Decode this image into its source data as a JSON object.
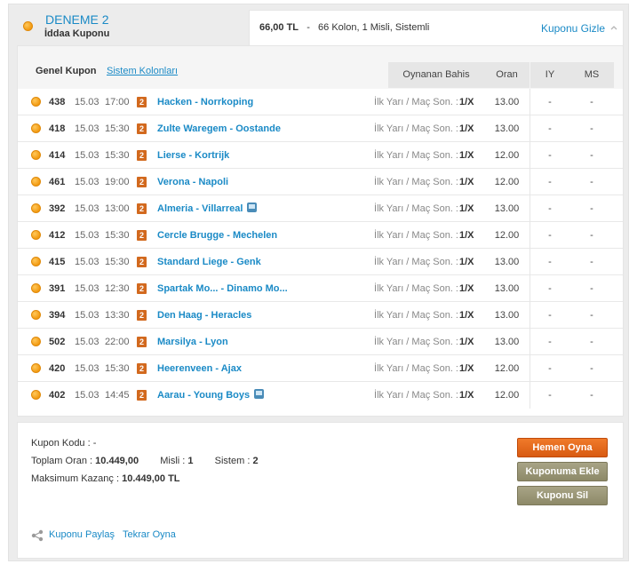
{
  "header": {
    "title": "DENEME 2",
    "subtitle": "İddaa Kuponu",
    "amount": "66,00 TL",
    "summary": "66 Kolon, 1 Misli, Sistemli",
    "hide_label": "Kuponu Gizle"
  },
  "tabs": {
    "general": "Genel Kupon",
    "system": "Sistem Kolonları"
  },
  "columns": {
    "bet": "Oynanan Bahis",
    "odds": "Oran",
    "iy": "IY",
    "ms": "MS"
  },
  "matches": [
    {
      "code": "438",
      "date": "15.03",
      "time": "17:00",
      "badge": "2",
      "teams": "Hacken - Norrkoping",
      "tv": false,
      "bet": "İlk Yarı / Maç Son. :",
      "sel": "1/X",
      "odds": "13.00",
      "iy": "-",
      "ms": "-"
    },
    {
      "code": "418",
      "date": "15.03",
      "time": "15:30",
      "badge": "2",
      "teams": "Zulte Waregem - Oostande",
      "tv": false,
      "bet": "İlk Yarı / Maç Son. :",
      "sel": "1/X",
      "odds": "13.00",
      "iy": "-",
      "ms": "-"
    },
    {
      "code": "414",
      "date": "15.03",
      "time": "15:30",
      "badge": "2",
      "teams": "Lierse - Kortrijk",
      "tv": false,
      "bet": "İlk Yarı / Maç Son. :",
      "sel": "1/X",
      "odds": "12.00",
      "iy": "-",
      "ms": "-"
    },
    {
      "code": "461",
      "date": "15.03",
      "time": "19:00",
      "badge": "2",
      "teams": "Verona - Napoli",
      "tv": false,
      "bet": "İlk Yarı / Maç Son. :",
      "sel": "1/X",
      "odds": "12.00",
      "iy": "-",
      "ms": "-"
    },
    {
      "code": "392",
      "date": "15.03",
      "time": "13:00",
      "badge": "2",
      "teams": "Almeria - Villarreal",
      "tv": true,
      "bet": "İlk Yarı / Maç Son. :",
      "sel": "1/X",
      "odds": "13.00",
      "iy": "-",
      "ms": "-"
    },
    {
      "code": "412",
      "date": "15.03",
      "time": "15:30",
      "badge": "2",
      "teams": "Cercle Brugge - Mechelen",
      "tv": false,
      "bet": "İlk Yarı / Maç Son. :",
      "sel": "1/X",
      "odds": "12.00",
      "iy": "-",
      "ms": "-"
    },
    {
      "code": "415",
      "date": "15.03",
      "time": "15:30",
      "badge": "2",
      "teams": "Standard Liege - Genk",
      "tv": false,
      "bet": "İlk Yarı / Maç Son. :",
      "sel": "1/X",
      "odds": "13.00",
      "iy": "-",
      "ms": "-"
    },
    {
      "code": "391",
      "date": "15.03",
      "time": "12:30",
      "badge": "2",
      "teams": "Spartak Mo... - Dinamo Mo...",
      "tv": false,
      "bet": "İlk Yarı / Maç Son. :",
      "sel": "1/X",
      "odds": "13.00",
      "iy": "-",
      "ms": "-"
    },
    {
      "code": "394",
      "date": "15.03",
      "time": "13:30",
      "badge": "2",
      "teams": "Den Haag - Heracles",
      "tv": false,
      "bet": "İlk Yarı / Maç Son. :",
      "sel": "1/X",
      "odds": "13.00",
      "iy": "-",
      "ms": "-"
    },
    {
      "code": "502",
      "date": "15.03",
      "time": "22:00",
      "badge": "2",
      "teams": "Marsilya - Lyon",
      "tv": false,
      "bet": "İlk Yarı / Maç Son. :",
      "sel": "1/X",
      "odds": "13.00",
      "iy": "-",
      "ms": "-"
    },
    {
      "code": "420",
      "date": "15.03",
      "time": "15:30",
      "badge": "2",
      "teams": "Heerenveen - Ajax",
      "tv": false,
      "bet": "İlk Yarı / Maç Son. :",
      "sel": "1/X",
      "odds": "12.00",
      "iy": "-",
      "ms": "-"
    },
    {
      "code": "402",
      "date": "15.03",
      "time": "14:45",
      "badge": "2",
      "teams": "Aarau - Young Boys",
      "tv": true,
      "bet": "İlk Yarı / Maç Son. :",
      "sel": "1/X",
      "odds": "12.00",
      "iy": "-",
      "ms": "-"
    }
  ],
  "footer": {
    "code_label": "Kupon Kodu :",
    "code_value": "-",
    "total_odds_label": "Toplam Oran :",
    "total_odds_value": "10.449,00",
    "multiplier_label": "Misli :",
    "multiplier_value": "1",
    "system_label": "Sistem :",
    "system_value": "2",
    "max_win_label": "Maksimum Kazanç :",
    "max_win_value": "10.449,00 TL",
    "play_button": "Hemen Oyna",
    "add_button": "Kuponuma Ekle",
    "delete_button": "Kuponu Sil",
    "share_label": "Kuponu Paylaş",
    "replay_label": "Tekrar Oyna"
  },
  "colors": {
    "link": "#1a8ac6",
    "play_button": "#e8691e",
    "secondary_button": "#9a9677",
    "badge": "#d2691e"
  },
  "icons": {
    "status": "orange-dot-icon",
    "tv": "tv-icon",
    "share": "share-icon",
    "collapse": "chevron-up-icon"
  }
}
